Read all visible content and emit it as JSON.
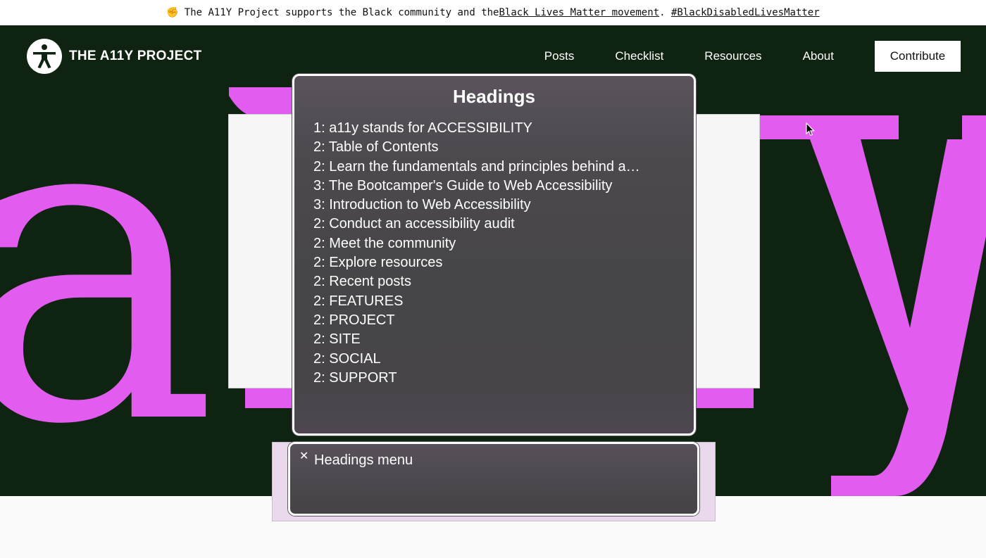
{
  "banner": {
    "icon": "raised-fist-icon",
    "text_prefix": "The A11Y Project supports the Black community and the ",
    "link1": "Black Lives Matter movement",
    "separator": ". ",
    "link2": "#BlackDisabledLivesMatter"
  },
  "header": {
    "logo_icon": "accessibility-person-icon",
    "logo_text": "THE A11Y PROJECT",
    "nav": [
      "Posts",
      "Checklist",
      "Resources",
      "About"
    ],
    "cta": "Contribute"
  },
  "hero": {
    "letters": [
      "a",
      "i",
      "y"
    ],
    "accent_color": "#e35cf0",
    "background_color": "#0f2410"
  },
  "headings_panel": {
    "title": "Headings",
    "items": [
      "1: a11y stands for ACCESSIBILITY",
      "2: Table of Contents",
      "2: Learn the fundamentals and principles behind a…",
      "3: The Bootcamper's Guide to Web Accessibility",
      "3: Introduction to Web Accessibility",
      "2: Conduct an accessibility audit",
      "2: Meet the community",
      "2: Explore resources",
      "2: Recent posts",
      "2: FEATURES",
      "2: PROJECT",
      "2: SITE",
      "2: SOCIAL",
      "2: SUPPORT"
    ]
  },
  "menu_panel": {
    "close_icon": "close-icon",
    "title": "Headings menu"
  }
}
